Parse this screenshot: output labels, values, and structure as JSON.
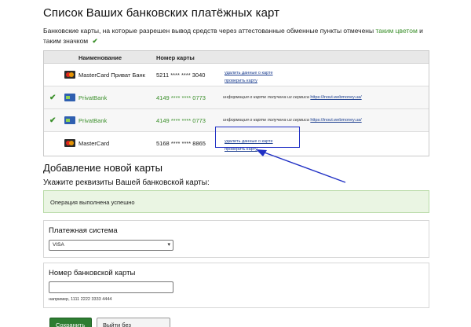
{
  "page": {
    "title": "Список Ваших банковских платёжных карт",
    "intro_prefix": "Банковские карты, на которые разрешен вывод средств через аттестованные обменные пункты отмечены",
    "intro_highlight": "таким цветом",
    "intro_suffix": "и таким значком",
    "intro_check": "✔"
  },
  "cards_table": {
    "headers": {
      "name": "Наименование",
      "number": "Номер карты"
    },
    "rows": [
      {
        "verified": false,
        "check": "",
        "logo": "mastercard-logo",
        "name": "MasterCard Приват Банк",
        "number": "5211 **** **** 3040",
        "action_delete": "удалить данные о карте",
        "action_verify": "проверить карту",
        "info_text": "",
        "info_link": ""
      },
      {
        "verified": true,
        "check": "✔",
        "logo": "privatbank-logo",
        "name": "PrivatBank",
        "number": "4149 **** **** 0773",
        "action_delete": "",
        "action_verify": "",
        "info_text": "информация о карте получена из сервиса",
        "info_link": "https://inout.webmoney.ua/"
      },
      {
        "verified": true,
        "check": "✔",
        "logo": "privatbank-logo",
        "name": "PrivatBank",
        "number": "4149 **** **** 0773",
        "action_delete": "",
        "action_verify": "",
        "info_text": "информация о карте получена из сервиса",
        "info_link": "https://inout.webmoney.ua/"
      },
      {
        "verified": false,
        "check": "",
        "logo": "mastercard-logo",
        "name": "MasterCard",
        "number": "5168 **** **** 8865",
        "action_delete": "удалить данные о карте",
        "action_verify": "проверить карту",
        "info_text": "",
        "info_link": ""
      }
    ]
  },
  "add_card": {
    "title": "Добавление новой карты",
    "subtitle": "Укажите реквизиты Вашей банковской карты:",
    "success_message": "Операция выполнена успешно",
    "payment_system_label": "Платежная система",
    "payment_system_value": "VISA",
    "card_number_label": "Номер банковской карты",
    "card_number_value": "",
    "card_number_hint": "например, 1111 2222 3333 4444",
    "save_label": "Сохранить",
    "exit_label": "Выйти без сохранения"
  },
  "colors": {
    "accent_green": "#3a8f2a",
    "highlight_box": "#1f2fc4",
    "link": "#1a3d8f"
  }
}
